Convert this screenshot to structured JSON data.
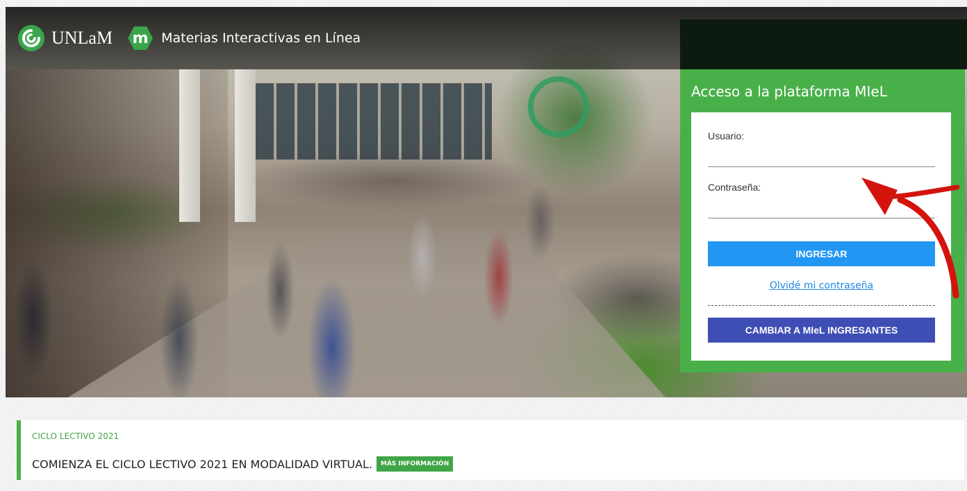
{
  "header": {
    "brand_name": "UNLaM",
    "brand_icon": "unlam-logo-icon",
    "platform_icon_letter": "m",
    "platform_name": "Materias Interactivas en Línea"
  },
  "login": {
    "title": "Acceso a la plataforma MIeL",
    "username_label": "Usuario:",
    "username_value": "",
    "password_label": "Contraseña:",
    "password_value": "",
    "submit_label": "INGRESAR",
    "forgot_label": "Olvidé mi contraseña",
    "switch_label": "CAMBIAR A MIeL INGRESANTES"
  },
  "news": {
    "tag": "CICLO LECTIVO 2021",
    "title": "COMIENZA EL CICLO LECTIVO 2021 EN MODALIDAD VIRTUAL.",
    "more_label": "MÁS INFORMACIÓN"
  },
  "colors": {
    "brand_green": "#49b049",
    "primary_blue": "#2196f3",
    "indigo": "#3f4eb5",
    "arrow_red": "#d3140d"
  }
}
